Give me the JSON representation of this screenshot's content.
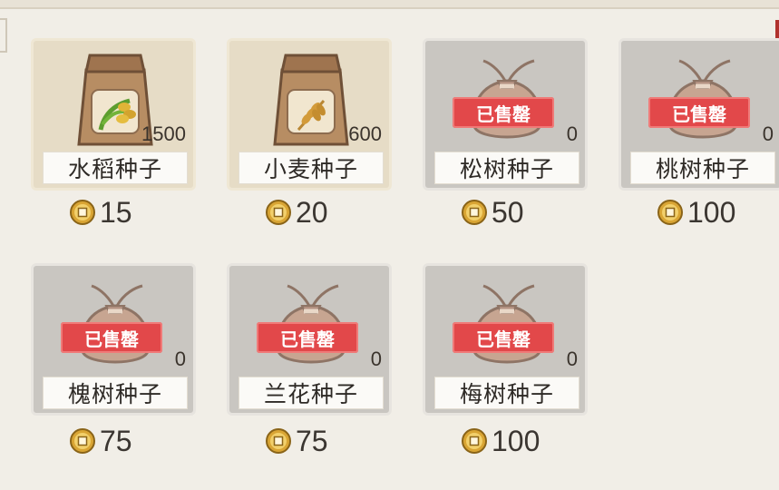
{
  "shop": {
    "sold_out_label": "已售罄",
    "items": [
      {
        "name": "水稻种子",
        "stock": "1500",
        "price": "15",
        "sold_out": false,
        "icon": "rice-seed-bag-icon"
      },
      {
        "name": "小麦种子",
        "stock": "600",
        "price": "20",
        "sold_out": false,
        "icon": "wheat-seed-bag-icon"
      },
      {
        "name": "松树种子",
        "stock": "0",
        "price": "50",
        "sold_out": true,
        "icon": "seed-sack-icon"
      },
      {
        "name": "桃树种子",
        "stock": "0",
        "price": "100",
        "sold_out": true,
        "icon": "seed-sack-icon"
      },
      {
        "name": "槐树种子",
        "stock": "0",
        "price": "75",
        "sold_out": true,
        "icon": "seed-sack-icon"
      },
      {
        "name": "兰花种子",
        "stock": "0",
        "price": "75",
        "sold_out": true,
        "icon": "seed-sack-icon"
      },
      {
        "name": "梅树种子",
        "stock": "0",
        "price": "100",
        "sold_out": true,
        "icon": "seed-sack-icon"
      }
    ]
  },
  "colors": {
    "background": "#f1eee7",
    "sold_badge": "#e2484a",
    "coin": "#d9a534"
  }
}
